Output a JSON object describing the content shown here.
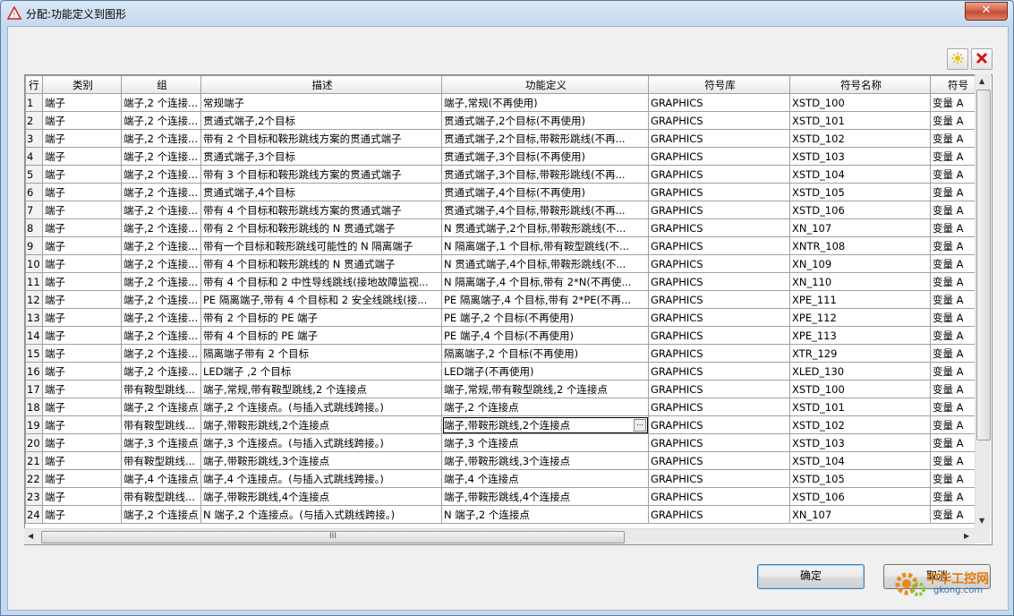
{
  "window": {
    "title": "分配:功能定义到图形",
    "close_label": "✕"
  },
  "toolbar": {
    "new_icon": "star-new-icon",
    "delete_icon": "red-x-delete-icon"
  },
  "table": {
    "columns": [
      "行",
      "类别",
      "组",
      "描述",
      "功能定义",
      "符号库",
      "符号名称",
      "符号"
    ],
    "rows": [
      [
        "1",
        "端子",
        "端子,2 个连接...",
        "常规端子",
        "端子,常规(不再使用)",
        "GRAPHICS",
        "XSTD_100",
        "变量 A"
      ],
      [
        "2",
        "端子",
        "端子,2 个连接...",
        "贯通式端子,2个目标",
        "贯通式端子,2个目标(不再使用)",
        "GRAPHICS",
        "XSTD_101",
        "变量 A"
      ],
      [
        "3",
        "端子",
        "端子,2 个连接...",
        "带有 2 个目标和鞍形跳线方案的贯通式端子",
        "贯通式端子,2个目标,带鞍形跳线(不再...",
        "GRAPHICS",
        "XSTD_102",
        "变量 A"
      ],
      [
        "4",
        "端子",
        "端子,2 个连接...",
        "贯通式端子,3个目标",
        "贯通式端子,3个目标(不再使用)",
        "GRAPHICS",
        "XSTD_103",
        "变量 A"
      ],
      [
        "5",
        "端子",
        "端子,2 个连接...",
        "带有 3 个目标和鞍形跳线方案的贯通式端子",
        "贯通式端子,3个目标,带鞍形跳线(不再...",
        "GRAPHICS",
        "XSTD_104",
        "变量 A"
      ],
      [
        "6",
        "端子",
        "端子,2 个连接...",
        "贯通式端子,4个目标",
        "贯通式端子,4个目标(不再使用)",
        "GRAPHICS",
        "XSTD_105",
        "变量 A"
      ],
      [
        "7",
        "端子",
        "端子,2 个连接...",
        "带有 4 个目标和鞍形跳线方案的贯通式端子",
        "贯通式端子,4个目标,带鞍形跳线(不再...",
        "GRAPHICS",
        "XSTD_106",
        "变量 A"
      ],
      [
        "8",
        "端子",
        "端子,2 个连接...",
        "带有 2 个目标和鞍形跳线的 N 贯通式端子",
        "N 贯通式端子,2个目标,带鞍形跳线(不...",
        "GRAPHICS",
        "XN_107",
        "变量 A"
      ],
      [
        "9",
        "端子",
        "端子,2 个连接...",
        "带有一个目标和鞍形跳线可能性的 N 隔离端子",
        "N 隔离端子,1 个目标,带有鞍型跳线(不...",
        "GRAPHICS",
        "XNTR_108",
        "变量 A"
      ],
      [
        "10",
        "端子",
        "端子,2 个连接...",
        "带有 4 个目标和鞍形跳线的 N 贯通式端子",
        "N 贯通式端子,4个目标,带鞍形跳线(不...",
        "GRAPHICS",
        "XN_109",
        "变量 A"
      ],
      [
        "11",
        "端子",
        "端子,2 个连接...",
        "带有 4 个目标和 2 中性导线跳线(接地故障监视...",
        "N 隔离端子,4 个目标,带有 2*N(不再使...",
        "GRAPHICS",
        "XN_110",
        "变量 A"
      ],
      [
        "12",
        "端子",
        "端子,2 个连接...",
        "PE 隔离端子,带有 4 个目标和 2 安全线跳线(接...",
        "PE 隔离端子,4 个目标,带有 2*PE(不再...",
        "GRAPHICS",
        "XPE_111",
        "变量 A"
      ],
      [
        "13",
        "端子",
        "端子,2 个连接...",
        "带有 2 个目标的 PE 端子",
        "PE 端子,2 个目标(不再使用)",
        "GRAPHICS",
        "XPE_112",
        "变量 A"
      ],
      [
        "14",
        "端子",
        "端子,2 个连接...",
        "带有 4 个目标的 PE 端子",
        "PE 端子,4 个目标(不再使用)",
        "GRAPHICS",
        "XPE_113",
        "变量 A"
      ],
      [
        "15",
        "端子",
        "端子,2 个连接...",
        "隔离端子带有 2 个目标",
        "隔离端子,2 个目标(不再使用)",
        "GRAPHICS",
        "XTR_129",
        "变量 A"
      ],
      [
        "16",
        "端子",
        "端子,2 个连接...",
        "LED端子 ,2 个目标",
        "LED端子(不再使用)",
        "GRAPHICS",
        "XLED_130",
        "变量 A"
      ],
      [
        "17",
        "端子",
        "带有鞍型跳线...",
        "端子,常规,带有鞍型跳线,2 个连接点",
        "端子,常规,带有鞍型跳线,2 个连接点",
        "GRAPHICS",
        "XSTD_100",
        "变量 A"
      ],
      [
        "18",
        "端子",
        "端子,2 个连接点",
        "端子,2 个连接点。(与插入式跳线跨接。)",
        "端子,2 个连接点",
        "GRAPHICS",
        "XSTD_101",
        "变量 A"
      ],
      [
        "19",
        "端子",
        "带有鞍型跳线...",
        "端子,带鞍形跳线,2个连接点",
        "端子,带鞍形跳线,2个连接点",
        "GRAPHICS",
        "XSTD_102",
        "变量 A"
      ],
      [
        "20",
        "端子",
        "端子,3 个连接点",
        "端子,3 个连接点。(与插入式跳线跨接。)",
        "端子,3 个连接点",
        "GRAPHICS",
        "XSTD_103",
        "变量 A"
      ],
      [
        "21",
        "端子",
        "带有鞍型跳线...",
        "端子,带鞍形跳线,3个连接点",
        "端子,带鞍形跳线,3个连接点",
        "GRAPHICS",
        "XSTD_104",
        "变量 A"
      ],
      [
        "22",
        "端子",
        "端子,4 个连接点",
        "端子,4 个连接点。(与插入式跳线跨接。)",
        "端子,4 个连接点",
        "GRAPHICS",
        "XSTD_105",
        "变量 A"
      ],
      [
        "23",
        "端子",
        "带有鞍型跳线...",
        "端子,带鞍形跳线,4个连接点",
        "端子,带鞍形跳线,4个连接点",
        "GRAPHICS",
        "XSTD_106",
        "变量 A"
      ],
      [
        "24",
        "端子",
        "端子,2 个连接点",
        "N 端子,2 个连接点。(与插入式跳线跨接。)",
        "N 端子,2 个连接点",
        "GRAPHICS",
        "XN_107",
        "变量 A"
      ]
    ],
    "selected_row": 19,
    "selected_col": 4
  },
  "scrollbar": {
    "h_thumb_grip": "III"
  },
  "buttons": {
    "ok": "确定",
    "cancel": "取消"
  },
  "watermark": {
    "line1": "中华工控网",
    "line2": "gkong.com"
  }
}
